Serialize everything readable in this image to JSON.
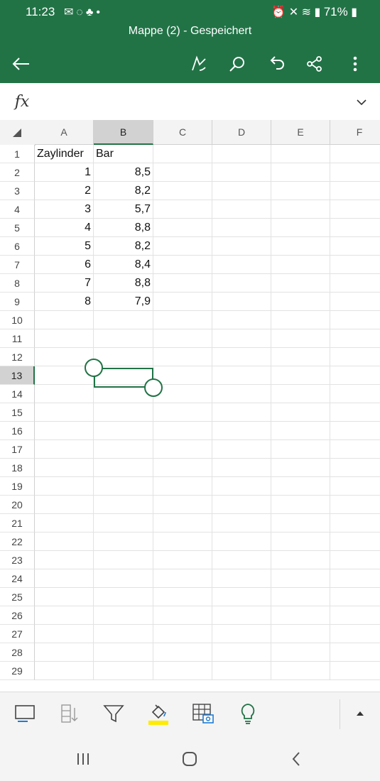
{
  "status_bar": {
    "time": "11:23",
    "left_icons": [
      "mail-icon",
      "whatsapp-icon",
      "notification-bell-icon",
      "dot-icon"
    ],
    "right_icons": [
      "alarm-icon",
      "mute-icon",
      "wifi-icon",
      "signal-icon"
    ],
    "battery": "71%"
  },
  "header": {
    "title": "Mappe (2) - Gespeichert"
  },
  "toolbar_top": {
    "icons": [
      "back-arrow-icon",
      "pen-draw-icon",
      "search-icon",
      "undo-icon",
      "share-icon",
      "more-icon"
    ]
  },
  "formula_bar": {
    "fx_label": "fx",
    "value": ""
  },
  "sheet": {
    "columns": [
      "A",
      "B",
      "C",
      "D",
      "E",
      "F"
    ],
    "selected_column": "B",
    "selected_row": "13",
    "rows": [
      {
        "n": "1",
        "A": "Zaylinder",
        "B": "Bar"
      },
      {
        "n": "2",
        "A": "1",
        "B": "8,5"
      },
      {
        "n": "3",
        "A": "2",
        "B": "8,2"
      },
      {
        "n": "4",
        "A": "3",
        "B": "5,7"
      },
      {
        "n": "5",
        "A": "4",
        "B": "8,8"
      },
      {
        "n": "6",
        "A": "5",
        "B": "8,2"
      },
      {
        "n": "7",
        "A": "6",
        "B": "8,4"
      },
      {
        "n": "8",
        "A": "7",
        "B": "8,8"
      },
      {
        "n": "9",
        "A": "8",
        "B": "7,9"
      },
      {
        "n": "10"
      },
      {
        "n": "11"
      },
      {
        "n": "12"
      },
      {
        "n": "13"
      },
      {
        "n": "14"
      },
      {
        "n": "15"
      },
      {
        "n": "16"
      },
      {
        "n": "17"
      },
      {
        "n": "18"
      },
      {
        "n": "19"
      },
      {
        "n": "20"
      },
      {
        "n": "21"
      },
      {
        "n": "22"
      },
      {
        "n": "23"
      },
      {
        "n": "24"
      },
      {
        "n": "25"
      },
      {
        "n": "26"
      },
      {
        "n": "27"
      },
      {
        "n": "28"
      },
      {
        "n": "29"
      }
    ]
  },
  "bottom_toolbar": {
    "icons": [
      "card-view-icon",
      "sort-icon",
      "filter-icon",
      "fill-color-icon",
      "insert-picture-table-icon",
      "lightbulb-icon",
      "expand-up-icon"
    ]
  },
  "nav_bar": {
    "icons": [
      "recent-apps-icon",
      "home-icon",
      "back-icon"
    ]
  },
  "colors": {
    "accent": "#217346",
    "fill_highlight": "#ffeb00"
  }
}
